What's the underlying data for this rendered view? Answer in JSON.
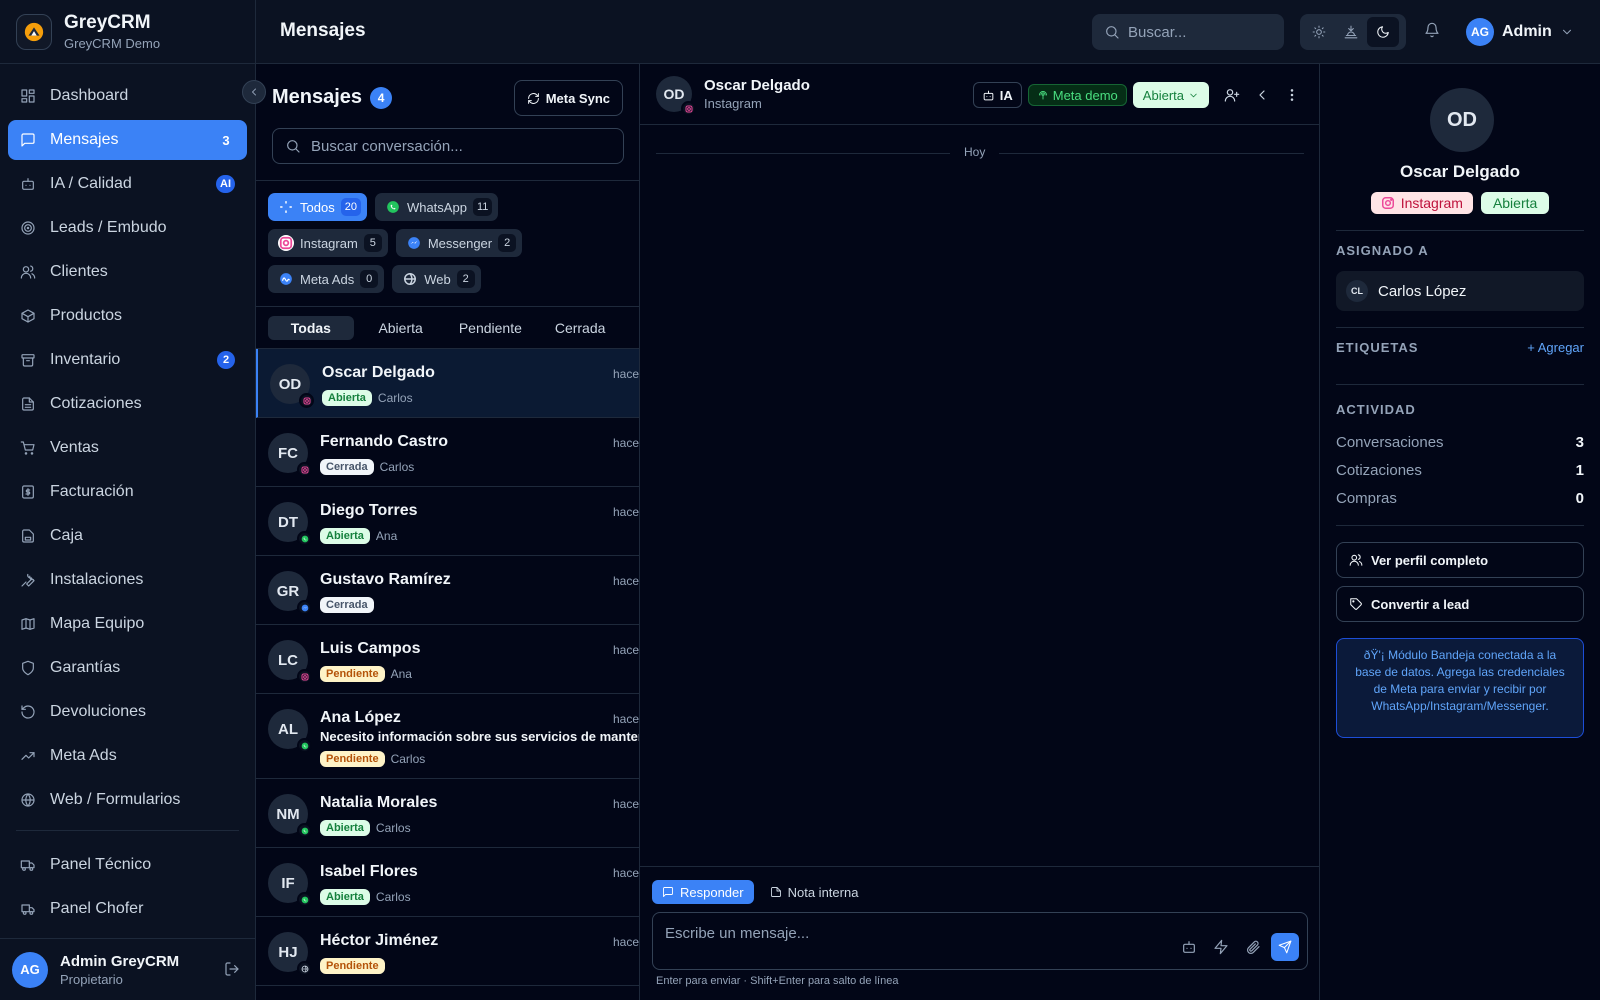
{
  "brand": {
    "name": "GreyCRM",
    "subtitle": "GreyCRM Demo"
  },
  "sidebar": {
    "items": [
      {
        "label": "Dashboard",
        "icon": "dashboard-icon",
        "badge": ""
      },
      {
        "label": "Mensajes",
        "icon": "message-icon",
        "badge": "3",
        "active": true
      },
      {
        "label": "IA / Calidad",
        "icon": "bot-icon",
        "badge": "AI"
      },
      {
        "label": "Leads / Embudo",
        "icon": "target-icon",
        "badge": ""
      },
      {
        "label": "Clientes",
        "icon": "users-icon",
        "badge": ""
      },
      {
        "label": "Productos",
        "icon": "package-icon",
        "badge": ""
      },
      {
        "label": "Inventario",
        "icon": "archive-icon",
        "badge": "2"
      },
      {
        "label": "Cotizaciones",
        "icon": "file-text-icon",
        "badge": ""
      },
      {
        "label": "Ventas",
        "icon": "cart-icon",
        "badge": ""
      },
      {
        "label": "Facturación",
        "icon": "receipt-icon",
        "badge": ""
      },
      {
        "label": "Caja",
        "icon": "cashbox-icon",
        "badge": ""
      },
      {
        "label": "Instalaciones",
        "icon": "wrench-icon",
        "badge": ""
      },
      {
        "label": "Mapa Equipo",
        "icon": "map-icon",
        "badge": ""
      },
      {
        "label": "Garantías",
        "icon": "shield-icon",
        "badge": ""
      },
      {
        "label": "Devoluciones",
        "icon": "rotate-ccw-icon",
        "badge": ""
      },
      {
        "label": "Meta Ads",
        "icon": "trending-up-icon",
        "badge": ""
      },
      {
        "label": "Web / Formularios",
        "icon": "globe-icon",
        "badge": ""
      }
    ],
    "bottom_items": [
      {
        "label": "Panel Técnico",
        "icon": "truck-icon"
      },
      {
        "label": "Panel Chofer",
        "icon": "van-icon"
      }
    ],
    "user": {
      "initials": "AG",
      "name": "Admin GreyCRM",
      "role": "Propietario"
    }
  },
  "topbar": {
    "title": "Mensajes",
    "search_placeholder": "Buscar...",
    "user_initials": "AG",
    "user_name": "Admin"
  },
  "inbox": {
    "title": "Mensajes",
    "count": "4",
    "sync_label": "Meta Sync",
    "search_placeholder": "Buscar conversación...",
    "channels": [
      [
        {
          "label": "Todos",
          "count": "20",
          "icon": "all-icon",
          "color": "#ffffff",
          "active": true
        },
        {
          "label": "WhatsApp",
          "count": "11",
          "icon": "whatsapp-icon",
          "color": "#22c55e"
        }
      ],
      [
        {
          "label": "Instagram",
          "count": "5",
          "icon": "instagram-icon",
          "color": "#ec4899"
        },
        {
          "label": "Messenger",
          "count": "2",
          "icon": "messenger-icon",
          "color": "#3b82f6"
        }
      ],
      [
        {
          "label": "Meta Ads",
          "count": "0",
          "icon": "meta-icon",
          "color": "#3b82f6"
        },
        {
          "label": "Web",
          "count": "2",
          "icon": "globe-icon",
          "color": "#94a3b8"
        }
      ]
    ],
    "status_tabs": [
      "Todas",
      "Abierta",
      "Pendiente",
      "Cerrada"
    ],
    "active_status": 0,
    "conversations": [
      {
        "initials": "OD",
        "name": "Oscar Delgado",
        "time": "hace",
        "status": "Abierta",
        "agent": "Carlos",
        "channel": "instagram",
        "message": "",
        "active": true
      },
      {
        "initials": "FC",
        "name": "Fernando Castro",
        "time": "hace",
        "status": "Cerrada",
        "agent": "Carlos",
        "channel": "instagram",
        "message": ""
      },
      {
        "initials": "DT",
        "name": "Diego Torres",
        "time": "hace",
        "status": "Abierta",
        "agent": "Ana",
        "channel": "whatsapp",
        "message": ""
      },
      {
        "initials": "GR",
        "name": "Gustavo Ramírez",
        "time": "hace",
        "status": "Cerrada",
        "agent": "",
        "channel": "messenger",
        "message": ""
      },
      {
        "initials": "LC",
        "name": "Luis Campos",
        "time": "hace",
        "status": "Pendiente",
        "agent": "Ana",
        "channel": "instagram",
        "message": ""
      },
      {
        "initials": "AL",
        "name": "Ana López",
        "time": "hace",
        "status": "Pendiente",
        "agent": "Carlos",
        "channel": "whatsapp",
        "message": "Necesito información sobre sus servicios de mantenimiento"
      },
      {
        "initials": "NM",
        "name": "Natalia Morales",
        "time": "hace",
        "status": "Abierta",
        "agent": "Carlos",
        "channel": "whatsapp",
        "message": ""
      },
      {
        "initials": "IF",
        "name": "Isabel Flores",
        "time": "hace",
        "status": "Abierta",
        "agent": "Carlos",
        "channel": "whatsapp",
        "message": ""
      },
      {
        "initials": "HJ",
        "name": "Héctor Jiménez",
        "time": "hace",
        "status": "Pendiente",
        "agent": "",
        "channel": "web",
        "message": ""
      }
    ]
  },
  "chat": {
    "initials": "OD",
    "name": "Oscar Delgado",
    "channel": "Instagram",
    "ia_label": "IA",
    "meta_label": "Meta demo",
    "status_label": "Abierta",
    "day_label": "Hoy",
    "reply_label": "Responder",
    "note_label": "Nota interna",
    "input_placeholder": "Escribe un mensaje...",
    "hint": "Enter para enviar · Shift+Enter para salto de línea"
  },
  "contact": {
    "initials": "OD",
    "name": "Oscar Delgado",
    "channel_tag": "Instagram",
    "status_tag": "Abierta",
    "assigned_label": "ASIGNADO A",
    "assignee_initials": "CL",
    "assignee_name": "Carlos López",
    "tags_label": "ETIQUETAS",
    "add_tag_label": "+ Agregar",
    "activity_label": "ACTIVIDAD",
    "stats": [
      {
        "label": "Conversaciones",
        "value": "3"
      },
      {
        "label": "Cotizaciones",
        "value": "1"
      },
      {
        "label": "Compras",
        "value": "0"
      }
    ],
    "view_profile_label": "Ver perfil completo",
    "convert_lead_label": "Convertir a lead",
    "info_text": "ðŸ'¡ Módulo Bandeja conectada a la base de datos. Agrega las credenciales de Meta para enviar y recibir por WhatsApp/Instagram/Messenger."
  },
  "colors": {
    "accent": "#3b82f6",
    "open": "#15803d",
    "pending": "#b45309",
    "closed": "#475569",
    "instagram": "#ec4899",
    "whatsapp": "#22c55e",
    "messenger": "#3b82f6"
  }
}
